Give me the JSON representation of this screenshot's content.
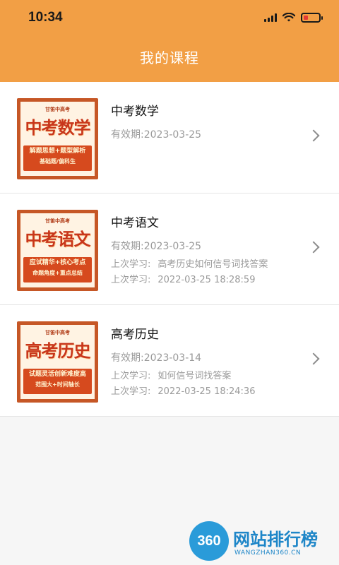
{
  "status_bar": {
    "time": "10:34"
  },
  "header": {
    "title": "我的课程"
  },
  "courses": [
    {
      "name": "中考数学",
      "validity": "有效期:2023-03-25",
      "cover": {
        "brand": "甘笛中高考",
        "title": "中考数学",
        "slogan1": "解题思想+题型解析",
        "slogan2": "基础题/偏科生"
      }
    },
    {
      "name": "中考语文",
      "validity": "有效期:2023-03-25",
      "recent_label_1": "上次学习:",
      "recent_value_1": "高考历史如何信号词找答案",
      "recent_label_2": "上次学习:",
      "recent_value_2": "2022-03-25 18:28:59",
      "cover": {
        "brand": "甘笛中高考",
        "title": "中考语文",
        "slogan1": "应试精华+核心考点",
        "slogan2": "命题角度+重点总结"
      }
    },
    {
      "name": "高考历史",
      "validity": "有效期:2023-03-14",
      "recent_label_1": "上次学习:",
      "recent_value_1": "如何信号词找答案",
      "recent_label_2": "上次学习:",
      "recent_value_2": "2022-03-25 18:24:36",
      "cover": {
        "brand": "甘笛中高考",
        "title": "高考历史",
        "slogan1": "试题灵活创新难度高",
        "slogan2": "范围大+时间轴长"
      }
    }
  ],
  "watermark": {
    "badge": "360",
    "name": "网站排行榜",
    "url": "WANGZHAN360.CN"
  }
}
